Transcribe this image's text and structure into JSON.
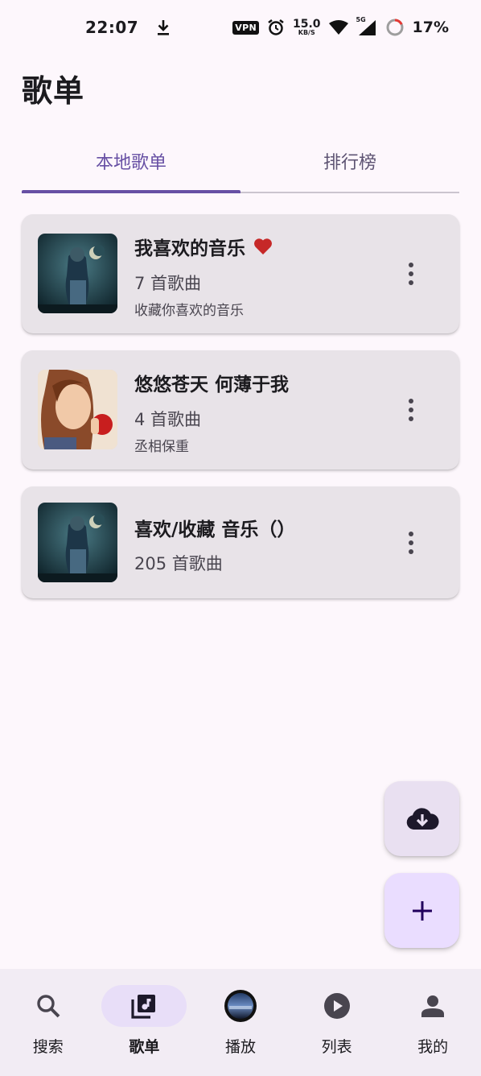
{
  "status_bar": {
    "time": "22:07",
    "vpn": "VPN",
    "speed_value": "15.0",
    "speed_unit": "KB/S",
    "network": "5G",
    "battery": "17%"
  },
  "header": {
    "title": "歌单"
  },
  "tabs": [
    {
      "label": "本地歌单",
      "active": true
    },
    {
      "label": "排行榜",
      "active": false
    }
  ],
  "playlists": [
    {
      "title": "我喜欢的音乐",
      "favorite": true,
      "count": "7 首歌曲",
      "description": "收藏你喜欢的音乐",
      "cover": "cover-fantasy"
    },
    {
      "title": "悠悠苍天 何薄于我",
      "favorite": false,
      "count": "4 首歌曲",
      "description": "丞相保重",
      "cover": "cover-portrait"
    },
    {
      "title": "喜欢/收藏 音乐（）",
      "favorite": false,
      "count": "205 首歌曲",
      "description": "",
      "cover": "cover-fantasy"
    }
  ],
  "fabs": {
    "download_icon": "cloud-download-icon",
    "add_icon": "plus-icon"
  },
  "bottom_nav": [
    {
      "label": "搜索",
      "icon": "search-icon",
      "active": false
    },
    {
      "label": "歌单",
      "icon": "music-library-icon",
      "active": true
    },
    {
      "label": "播放",
      "icon": "now-playing-disc-icon",
      "active": false
    },
    {
      "label": "列表",
      "icon": "play-circle-icon",
      "active": false
    },
    {
      "label": "我的",
      "icon": "person-icon",
      "active": false
    }
  ],
  "colors": {
    "accent": "#6750a4",
    "heart": "#c62828",
    "background": "#fdf7fc",
    "card": "#e8e3e8"
  }
}
